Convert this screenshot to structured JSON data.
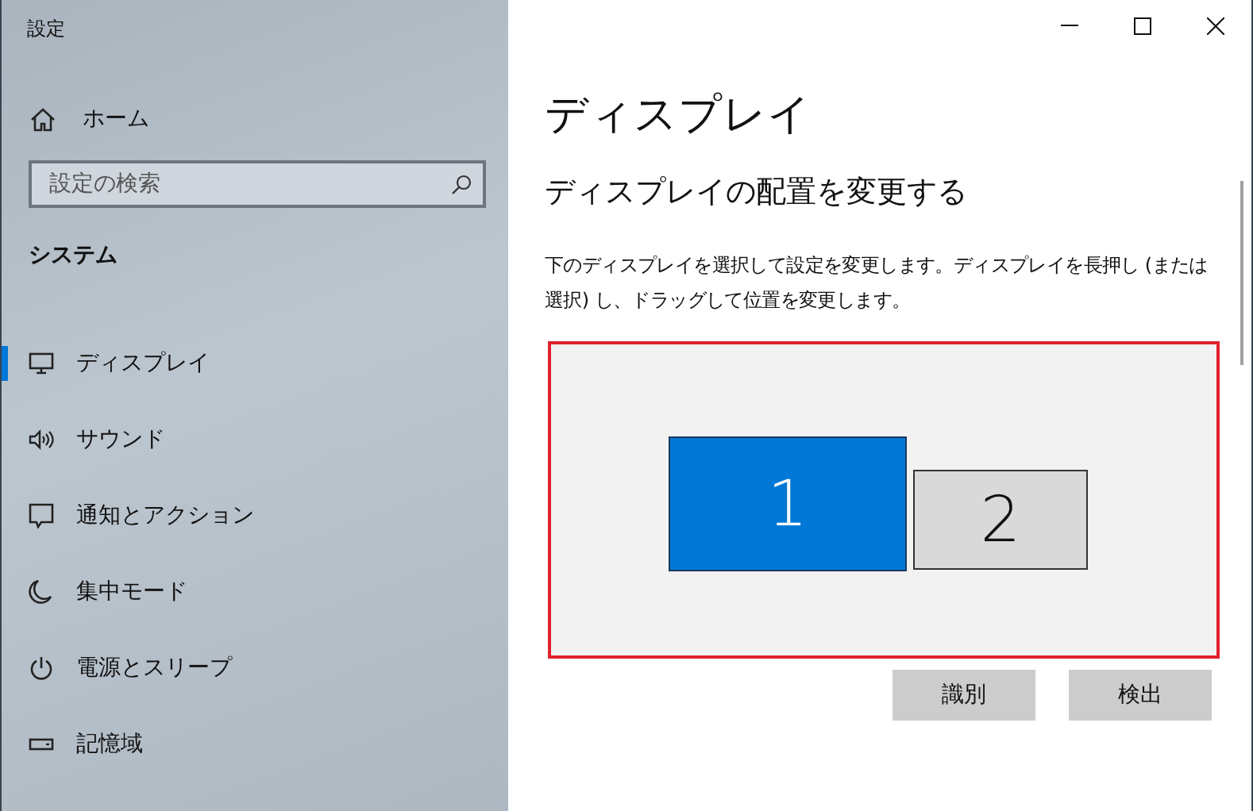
{
  "window": {
    "title": "設定"
  },
  "sidebar": {
    "home": "ホーム",
    "search": {
      "placeholder": "設定の検索"
    },
    "section": "システム",
    "items": [
      {
        "label": "ディスプレイ",
        "selected": true
      },
      {
        "label": "サウンド",
        "selected": false
      },
      {
        "label": "通知とアクション",
        "selected": false
      },
      {
        "label": "集中モード",
        "selected": false
      },
      {
        "label": "電源とスリープ",
        "selected": false
      },
      {
        "label": "記憶域",
        "selected": false
      }
    ]
  },
  "page": {
    "title": "ディスプレイ",
    "subtitle": "ディスプレイの配置を変更する",
    "description": "下のディスプレイを選択して設定を変更します。ディスプレイを長押し (または選択) し、ドラッグして位置を変更します。",
    "monitors": [
      {
        "number": "1",
        "selected": true
      },
      {
        "number": "2",
        "selected": false
      }
    ],
    "buttons": [
      "識別",
      "検出"
    ]
  }
}
